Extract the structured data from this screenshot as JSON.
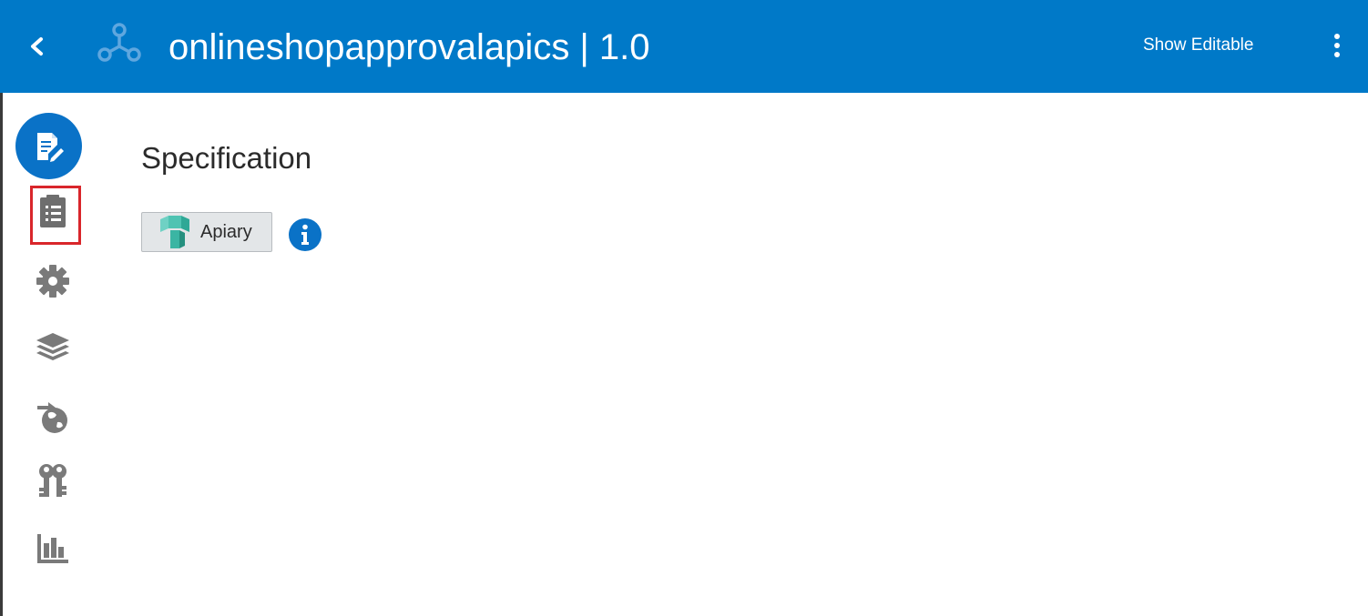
{
  "header": {
    "title": "onlineshopapprovalapics | 1.0",
    "show_editable_label": "Show Editable",
    "background_color": "#0079c8",
    "icons": {
      "back": "chevron-left-icon",
      "logo": "api-network-icon",
      "menu": "kebab-menu-icon"
    }
  },
  "sidebar": {
    "items": [
      {
        "icon": "document-edit-icon",
        "active": true
      },
      {
        "icon": "list-document-icon",
        "highlighted": true
      },
      {
        "icon": "gear-icon"
      },
      {
        "icon": "layers-icon"
      },
      {
        "icon": "globe-arrow-icon"
      },
      {
        "icon": "keys-icon"
      },
      {
        "icon": "bar-chart-icon"
      }
    ],
    "active_color": "#0a72c7",
    "icon_color": "#7a7a7a",
    "highlight_color": "#d9262b"
  },
  "main": {
    "section_title": "Specification",
    "apiary_button_label": "Apiary",
    "info_icon": "info-icon"
  }
}
